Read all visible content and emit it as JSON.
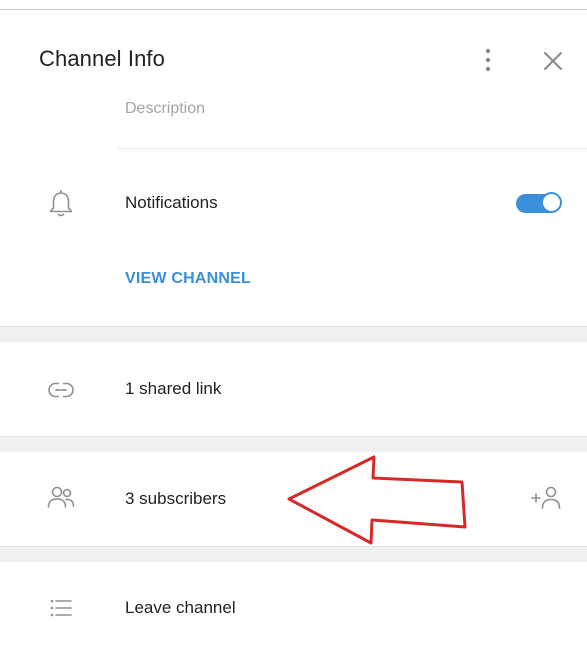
{
  "window": {
    "title": "Channel Info"
  },
  "header": {
    "menu_icon": "more-vertical-icon",
    "close_icon": "close-icon"
  },
  "description": {
    "placeholder": "Description"
  },
  "notifications": {
    "label": "Notifications",
    "icon": "bell-icon",
    "enabled": true,
    "toggle_color": "#3a8fd9"
  },
  "view_channel": {
    "label": "VIEW CHANNEL"
  },
  "shared_links": {
    "label": "1 shared link",
    "icon": "link-icon"
  },
  "subscribers": {
    "label": "3 subscribers",
    "icon": "users-icon",
    "add_icon": "add-user-icon"
  },
  "leave": {
    "label": "Leave channel",
    "icon": "list-icon"
  },
  "annotation": {
    "icon": "red-arrow-icon",
    "color": "#d42a2a"
  },
  "colors": {
    "accent": "#3a8fd9",
    "text": "#222222",
    "muted": "#a5a5a5",
    "separator": "#f0f0f0"
  }
}
